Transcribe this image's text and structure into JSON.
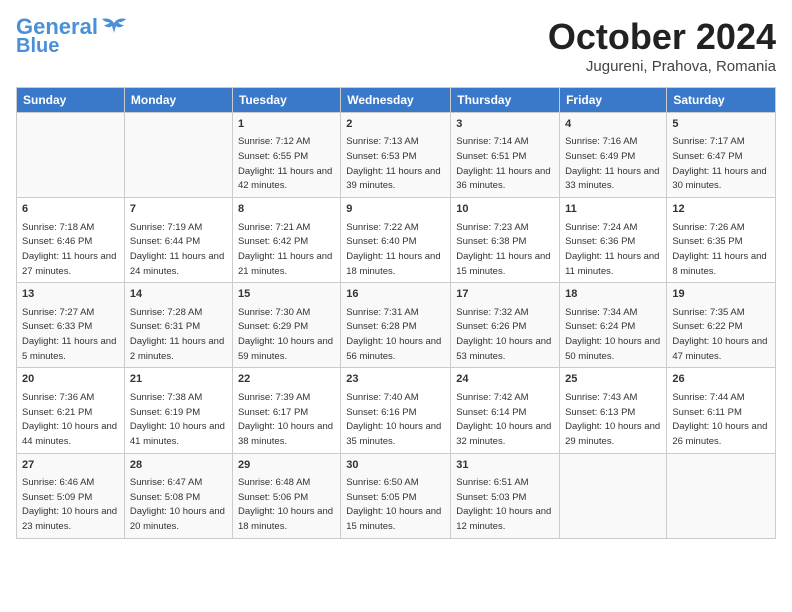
{
  "header": {
    "logo_line1": "General",
    "logo_line2": "Blue",
    "month": "October 2024",
    "location": "Jugureni, Prahova, Romania"
  },
  "weekdays": [
    "Sunday",
    "Monday",
    "Tuesday",
    "Wednesday",
    "Thursday",
    "Friday",
    "Saturday"
  ],
  "weeks": [
    [
      {
        "day": "",
        "sunrise": "",
        "sunset": "",
        "daylight": ""
      },
      {
        "day": "",
        "sunrise": "",
        "sunset": "",
        "daylight": ""
      },
      {
        "day": "1",
        "sunrise": "Sunrise: 7:12 AM",
        "sunset": "Sunset: 6:55 PM",
        "daylight": "Daylight: 11 hours and 42 minutes."
      },
      {
        "day": "2",
        "sunrise": "Sunrise: 7:13 AM",
        "sunset": "Sunset: 6:53 PM",
        "daylight": "Daylight: 11 hours and 39 minutes."
      },
      {
        "day": "3",
        "sunrise": "Sunrise: 7:14 AM",
        "sunset": "Sunset: 6:51 PM",
        "daylight": "Daylight: 11 hours and 36 minutes."
      },
      {
        "day": "4",
        "sunrise": "Sunrise: 7:16 AM",
        "sunset": "Sunset: 6:49 PM",
        "daylight": "Daylight: 11 hours and 33 minutes."
      },
      {
        "day": "5",
        "sunrise": "Sunrise: 7:17 AM",
        "sunset": "Sunset: 6:47 PM",
        "daylight": "Daylight: 11 hours and 30 minutes."
      }
    ],
    [
      {
        "day": "6",
        "sunrise": "Sunrise: 7:18 AM",
        "sunset": "Sunset: 6:46 PM",
        "daylight": "Daylight: 11 hours and 27 minutes."
      },
      {
        "day": "7",
        "sunrise": "Sunrise: 7:19 AM",
        "sunset": "Sunset: 6:44 PM",
        "daylight": "Daylight: 11 hours and 24 minutes."
      },
      {
        "day": "8",
        "sunrise": "Sunrise: 7:21 AM",
        "sunset": "Sunset: 6:42 PM",
        "daylight": "Daylight: 11 hours and 21 minutes."
      },
      {
        "day": "9",
        "sunrise": "Sunrise: 7:22 AM",
        "sunset": "Sunset: 6:40 PM",
        "daylight": "Daylight: 11 hours and 18 minutes."
      },
      {
        "day": "10",
        "sunrise": "Sunrise: 7:23 AM",
        "sunset": "Sunset: 6:38 PM",
        "daylight": "Daylight: 11 hours and 15 minutes."
      },
      {
        "day": "11",
        "sunrise": "Sunrise: 7:24 AM",
        "sunset": "Sunset: 6:36 PM",
        "daylight": "Daylight: 11 hours and 11 minutes."
      },
      {
        "day": "12",
        "sunrise": "Sunrise: 7:26 AM",
        "sunset": "Sunset: 6:35 PM",
        "daylight": "Daylight: 11 hours and 8 minutes."
      }
    ],
    [
      {
        "day": "13",
        "sunrise": "Sunrise: 7:27 AM",
        "sunset": "Sunset: 6:33 PM",
        "daylight": "Daylight: 11 hours and 5 minutes."
      },
      {
        "day": "14",
        "sunrise": "Sunrise: 7:28 AM",
        "sunset": "Sunset: 6:31 PM",
        "daylight": "Daylight: 11 hours and 2 minutes."
      },
      {
        "day": "15",
        "sunrise": "Sunrise: 7:30 AM",
        "sunset": "Sunset: 6:29 PM",
        "daylight": "Daylight: 10 hours and 59 minutes."
      },
      {
        "day": "16",
        "sunrise": "Sunrise: 7:31 AM",
        "sunset": "Sunset: 6:28 PM",
        "daylight": "Daylight: 10 hours and 56 minutes."
      },
      {
        "day": "17",
        "sunrise": "Sunrise: 7:32 AM",
        "sunset": "Sunset: 6:26 PM",
        "daylight": "Daylight: 10 hours and 53 minutes."
      },
      {
        "day": "18",
        "sunrise": "Sunrise: 7:34 AM",
        "sunset": "Sunset: 6:24 PM",
        "daylight": "Daylight: 10 hours and 50 minutes."
      },
      {
        "day": "19",
        "sunrise": "Sunrise: 7:35 AM",
        "sunset": "Sunset: 6:22 PM",
        "daylight": "Daylight: 10 hours and 47 minutes."
      }
    ],
    [
      {
        "day": "20",
        "sunrise": "Sunrise: 7:36 AM",
        "sunset": "Sunset: 6:21 PM",
        "daylight": "Daylight: 10 hours and 44 minutes."
      },
      {
        "day": "21",
        "sunrise": "Sunrise: 7:38 AM",
        "sunset": "Sunset: 6:19 PM",
        "daylight": "Daylight: 10 hours and 41 minutes."
      },
      {
        "day": "22",
        "sunrise": "Sunrise: 7:39 AM",
        "sunset": "Sunset: 6:17 PM",
        "daylight": "Daylight: 10 hours and 38 minutes."
      },
      {
        "day": "23",
        "sunrise": "Sunrise: 7:40 AM",
        "sunset": "Sunset: 6:16 PM",
        "daylight": "Daylight: 10 hours and 35 minutes."
      },
      {
        "day": "24",
        "sunrise": "Sunrise: 7:42 AM",
        "sunset": "Sunset: 6:14 PM",
        "daylight": "Daylight: 10 hours and 32 minutes."
      },
      {
        "day": "25",
        "sunrise": "Sunrise: 7:43 AM",
        "sunset": "Sunset: 6:13 PM",
        "daylight": "Daylight: 10 hours and 29 minutes."
      },
      {
        "day": "26",
        "sunrise": "Sunrise: 7:44 AM",
        "sunset": "Sunset: 6:11 PM",
        "daylight": "Daylight: 10 hours and 26 minutes."
      }
    ],
    [
      {
        "day": "27",
        "sunrise": "Sunrise: 6:46 AM",
        "sunset": "Sunset: 5:09 PM",
        "daylight": "Daylight: 10 hours and 23 minutes."
      },
      {
        "day": "28",
        "sunrise": "Sunrise: 6:47 AM",
        "sunset": "Sunset: 5:08 PM",
        "daylight": "Daylight: 10 hours and 20 minutes."
      },
      {
        "day": "29",
        "sunrise": "Sunrise: 6:48 AM",
        "sunset": "Sunset: 5:06 PM",
        "daylight": "Daylight: 10 hours and 18 minutes."
      },
      {
        "day": "30",
        "sunrise": "Sunrise: 6:50 AM",
        "sunset": "Sunset: 5:05 PM",
        "daylight": "Daylight: 10 hours and 15 minutes."
      },
      {
        "day": "31",
        "sunrise": "Sunrise: 6:51 AM",
        "sunset": "Sunset: 5:03 PM",
        "daylight": "Daylight: 10 hours and 12 minutes."
      },
      {
        "day": "",
        "sunrise": "",
        "sunset": "",
        "daylight": ""
      },
      {
        "day": "",
        "sunrise": "",
        "sunset": "",
        "daylight": ""
      }
    ]
  ]
}
